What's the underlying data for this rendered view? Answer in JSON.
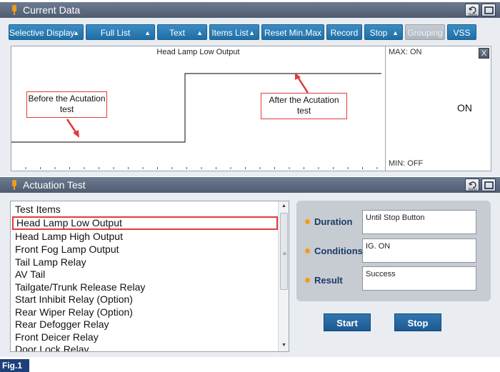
{
  "current_data": {
    "title": "Current Data",
    "retry_label": "Retry",
    "toolbar": {
      "selective_display": "Selective Display",
      "full_list": "Full List",
      "text": "Text",
      "items_list": "Items List",
      "reset_min_max": "Reset Min.Max",
      "record": "Record",
      "stop": "Stop",
      "grouping": "Grouping",
      "vss": "VSS"
    },
    "graph": {
      "title": "Head Lamp Low Output",
      "max_label": "MAX: ON",
      "min_label": "MIN: OFF",
      "current_value": "ON",
      "close_label": "X",
      "callout_before": "Before the Acutation test",
      "callout_after": "After the Acutation test"
    },
    "chart_data": {
      "type": "line",
      "title": "Head Lamp Low Output",
      "states": [
        "OFF",
        "ON"
      ],
      "series": [
        {
          "values": [
            "OFF",
            "ON"
          ]
        }
      ]
    }
  },
  "actuation": {
    "title": "Actuation Test",
    "retry_label": "Retry",
    "list_header": "Test Items",
    "items": [
      "Head Lamp Low Output",
      "Head Lamp High Output",
      "Front Fog Lamp Output",
      "Tail Lamp Relay",
      "AV Tail",
      "Tailgate/Trunk Release Relay",
      "Start Inhibit Relay (Option)",
      "Rear Wiper Relay (Option)",
      "Rear Defogger Relay",
      "Front Deicer Relay",
      "Door Lock Relay"
    ],
    "selected_item": "Head Lamp Low Output",
    "duration_label": "Duration",
    "duration_value": "Until Stop Button",
    "conditions_label": "Conditions",
    "conditions_value": "IG. ON",
    "result_label": "Result",
    "result_value": "Success",
    "start_button": "Start",
    "stop_button": "Stop"
  },
  "figure_label": "Fig.1",
  "colors": {
    "title_bar": "#56647a",
    "toolbar_button": "#2a7fb8",
    "highlight_red": "#e23a3a",
    "action_button": "#1f5f98",
    "bullet_orange": "#f39c1a"
  }
}
